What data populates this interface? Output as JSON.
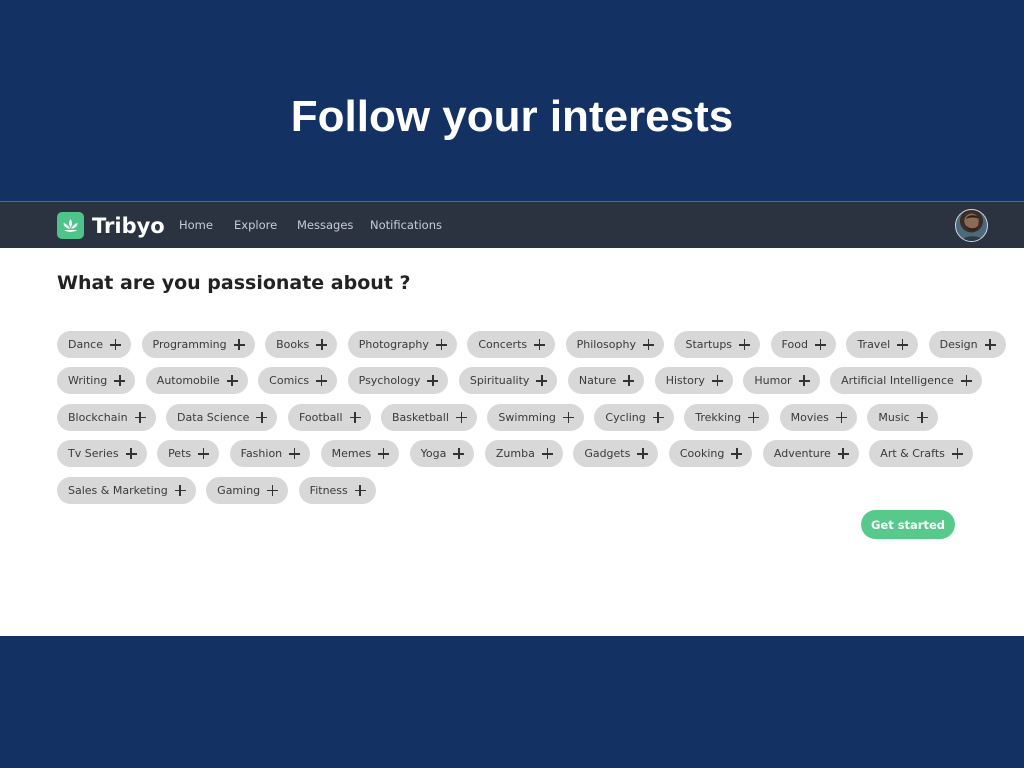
{
  "slide": {
    "title": "Follow your interests"
  },
  "app": {
    "brand": "Tribyo",
    "nav": [
      "Home",
      "Explore",
      "Messages",
      "Notifications"
    ],
    "heading": "What are you passionate about ?",
    "cta": "Get started",
    "colors": {
      "accent": "#57c98a",
      "navbar": "#2b3340",
      "backdrop": "#133263",
      "tag_bg": "#d8d8d8"
    }
  },
  "tags": [
    [
      "Dance",
      "Programming",
      "Books",
      "Photography",
      "Concerts",
      "Philosophy",
      "Startups",
      "Food",
      "Travel",
      "Design"
    ],
    [
      "Writing",
      "Automobile",
      "Comics",
      "Psychology",
      "Spirituality",
      "Nature",
      "History",
      "Humor",
      "Artificial Intelligence"
    ],
    [
      "Blockchain",
      "Data Science",
      "Football",
      "Basketball",
      "Swimming",
      "Cycling",
      "Trekking",
      "Movies",
      "Music"
    ],
    [
      "Tv Series",
      "Pets",
      "Fashion",
      "Memes",
      "Yoga",
      "Zumba",
      "Gadgets",
      "Cooking",
      "Adventure",
      "Art & Crafts"
    ],
    [
      "Sales & Marketing",
      "Gaming",
      "Fitness"
    ]
  ],
  "icons": {
    "logo": "lotus-icon",
    "tag_action": "plus-icon",
    "profile": "avatar"
  }
}
